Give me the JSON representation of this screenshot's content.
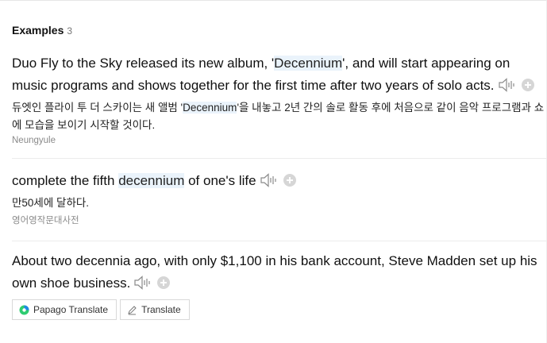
{
  "header": {
    "title": "Examples",
    "count": "3"
  },
  "examples": [
    {
      "sentence_pre": "Duo Fly to the Sky released its new album, '",
      "sentence_hl": "Decennium",
      "sentence_post": "', and will start appearing on music programs and shows together for the first time after two years of solo acts.",
      "translation_pre": "듀엣인 플라이 투 더 스카이는 새 앨범 '",
      "translation_hl": "Decennium",
      "translation_post": "'을 내놓고 2년 간의 솔로 활동 후에 처음으로 같이 음악 프로그램과 쇼에 모습을 보이기 시작할 것이다.",
      "source": "Neungyule"
    },
    {
      "sentence_pre": "complete the fifth ",
      "sentence_hl": "decennium",
      "sentence_post": " of one's life",
      "translation": "만50세에 달하다.",
      "source": "영어영작문대사전"
    },
    {
      "sentence": "About two decennia ago, with only $1,100 in his bank account, Steve Madden set up his own shoe business."
    }
  ],
  "buttons": {
    "papago": "Papago Translate",
    "translate": "Translate"
  },
  "colors": {
    "highlight": "#eaf3fb",
    "papago_green": "#2ecc71",
    "papago_blue": "#1e88e5"
  }
}
